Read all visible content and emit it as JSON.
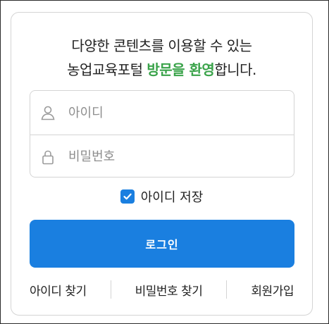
{
  "welcome": {
    "line1": "다양한 콘텐츠를 이용할 수 있는",
    "line2_prefix": "농업교육포털 ",
    "line2_accent": "방문을 환영",
    "line2_suffix": "합니다."
  },
  "form": {
    "id_placeholder": "아이디",
    "pw_placeholder": "비밀번호",
    "save_id_label": "아이디 저장",
    "save_id_checked": true,
    "login_label": "로그인"
  },
  "links": {
    "find_id": "아이디 찾기",
    "find_pw": "비밀번호 찾기",
    "signup": "회원가입"
  },
  "colors": {
    "accent_green": "#3aa34a",
    "primary_blue": "#1a7fe0"
  },
  "icons": {
    "id_field": "user-icon",
    "pw_field": "lock-icon",
    "checkbox": "check-icon"
  }
}
